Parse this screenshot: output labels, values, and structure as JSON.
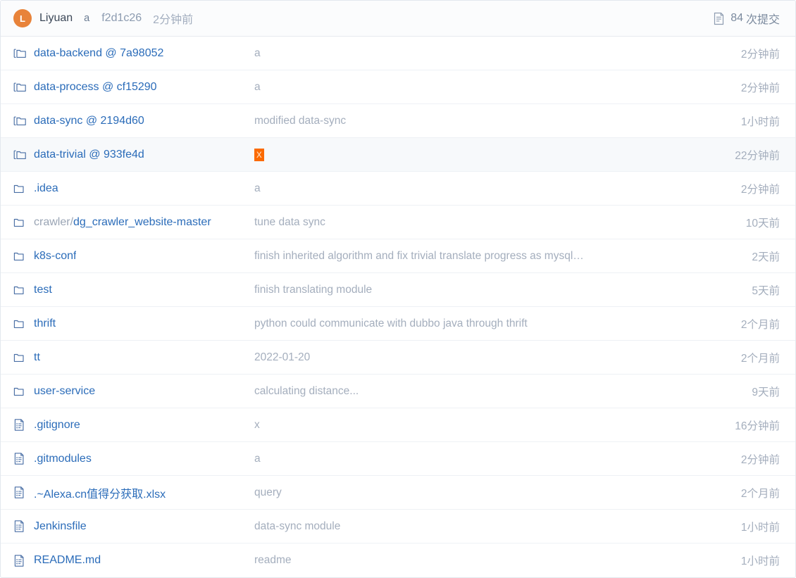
{
  "header": {
    "avatar_initial": "L",
    "author": "Liyuan",
    "commit_message": "a",
    "commit_sha": "f2d1c26",
    "commit_time": "2分钟前",
    "commits_icon": "history-document-icon",
    "commits_count": "84",
    "commits_label": "次提交"
  },
  "colors": {
    "link": "#2b6cb9",
    "muted": "#a4aebd",
    "avatar_orange": "#e8833a",
    "selection_orange": "#fb6a00",
    "row_selected_bg": "#f7f9fb",
    "border": "#eef1f5"
  },
  "rows": [
    {
      "icon": "submodule-folder-icon",
      "name": "data-backend @ 7a98052",
      "prefix": "",
      "message": "a",
      "time": "2分钟前",
      "selected": false,
      "highlight": false
    },
    {
      "icon": "submodule-folder-icon",
      "name": "data-process @ cf15290",
      "prefix": "",
      "message": "a",
      "time": "2分钟前",
      "selected": false,
      "highlight": false
    },
    {
      "icon": "submodule-folder-icon",
      "name": "data-sync @ 2194d60",
      "prefix": "",
      "message": "modified data-sync",
      "time": "1小时前",
      "selected": false,
      "highlight": false
    },
    {
      "icon": "submodule-folder-icon",
      "name": "data-trivial @ 933fe4d",
      "prefix": "",
      "message": "x",
      "time": "22分钟前",
      "selected": true,
      "highlight": true
    },
    {
      "icon": "folder-icon",
      "name": ".idea",
      "prefix": "",
      "message": "a",
      "time": "2分钟前",
      "selected": false,
      "highlight": false
    },
    {
      "icon": "folder-icon",
      "name": "dg_crawler_website-master",
      "prefix": "crawler/",
      "message": "tune data sync",
      "time": "10天前",
      "selected": false,
      "highlight": false
    },
    {
      "icon": "folder-icon",
      "name": "k8s-conf",
      "prefix": "",
      "message": "finish inherited algorithm and fix trivial translate progress as mysql…",
      "time": "2天前",
      "selected": false,
      "highlight": false
    },
    {
      "icon": "folder-icon",
      "name": "test",
      "prefix": "",
      "message": "finish translating module",
      "time": "5天前",
      "selected": false,
      "highlight": false
    },
    {
      "icon": "folder-icon",
      "name": "thrift",
      "prefix": "",
      "message": "python could communicate with dubbo java through thrift",
      "time": "2个月前",
      "selected": false,
      "highlight": false
    },
    {
      "icon": "folder-icon",
      "name": "tt",
      "prefix": "",
      "message": "2022-01-20",
      "time": "2个月前",
      "selected": false,
      "highlight": false
    },
    {
      "icon": "folder-icon",
      "name": "user-service",
      "prefix": "",
      "message": "calculating distance...",
      "time": "9天前",
      "selected": false,
      "highlight": false
    },
    {
      "icon": "file-icon",
      "name": ".gitignore",
      "prefix": "",
      "message": "x",
      "time": "16分钟前",
      "selected": false,
      "highlight": false
    },
    {
      "icon": "file-icon",
      "name": ".gitmodules",
      "prefix": "",
      "message": "a",
      "time": "2分钟前",
      "selected": false,
      "highlight": false
    },
    {
      "icon": "file-icon",
      "name": ".~Alexa.cn值得分获取.xlsx",
      "prefix": "",
      "message": "query",
      "time": "2个月前",
      "selected": false,
      "highlight": false
    },
    {
      "icon": "file-icon",
      "name": "Jenkinsfile",
      "prefix": "",
      "message": "data-sync module",
      "time": "1小时前",
      "selected": false,
      "highlight": false
    },
    {
      "icon": "file-icon",
      "name": "README.md",
      "prefix": "",
      "message": "readme",
      "time": "1小时前",
      "selected": false,
      "highlight": false
    }
  ]
}
